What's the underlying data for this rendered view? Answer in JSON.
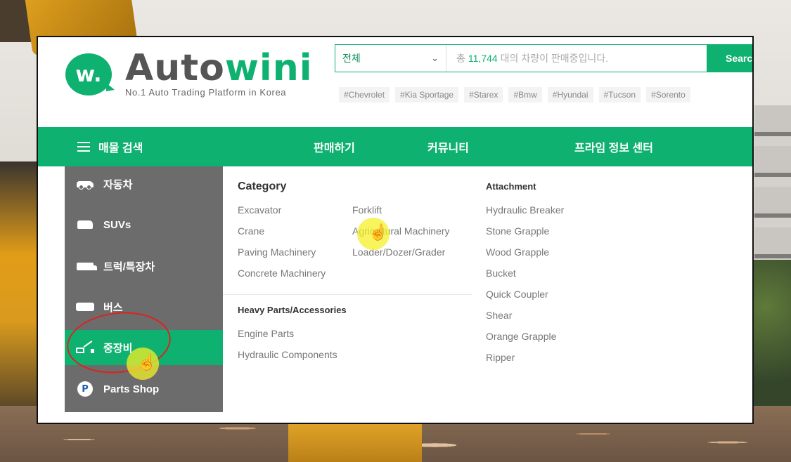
{
  "header": {
    "logo_mark": "w.",
    "logo_auto": "Auto",
    "logo_wini": "wini",
    "tagline": "No.1 Auto Trading Platform in Korea"
  },
  "search": {
    "category_value": "전체",
    "placeholder_prefix": "총",
    "vehicle_count": "11,744",
    "placeholder_suffix": "대의 차량이 판매중입니다.",
    "button_label": "Search"
  },
  "tags": [
    "#Chevrolet",
    "#Kia Sportage",
    "#Starex",
    "#Bmw",
    "#Hyundai",
    "#Tucson",
    "#Sorento"
  ],
  "nav": {
    "menu_label": "매물 검색",
    "items": [
      "판매하기",
      "커뮤니티",
      "프라임 정보 센터"
    ]
  },
  "sidebar": {
    "items": [
      {
        "label": "자동차",
        "icon": "car-icon"
      },
      {
        "label": "SUVs",
        "icon": "suv-icon"
      },
      {
        "label": "트럭/특장차",
        "icon": "truck-icon"
      },
      {
        "label": "버스",
        "icon": "bus-icon"
      },
      {
        "label": "중장비",
        "icon": "excavator-icon",
        "active": true
      },
      {
        "label": "Parts Shop",
        "icon": "parts-shop-icon"
      }
    ]
  },
  "category": {
    "title": "Category",
    "col1": [
      "Excavator",
      "Crane",
      "Paving Machinery",
      "Concrete Machinery"
    ],
    "col2": [
      "Forklift",
      "Agricultural Machinery",
      "Loader/Dozer/Grader"
    ]
  },
  "heavy_parts": {
    "title": "Heavy Parts/Accessories",
    "items": [
      "Engine Parts",
      "Hydraulic Components"
    ]
  },
  "attachment": {
    "title": "Attachment",
    "items": [
      "Hydraulic Breaker",
      "Stone Grapple",
      "Wood Grapple",
      "Bucket",
      "Quick Coupler",
      "Shear",
      "Orange Grapple",
      "Ripper"
    ]
  },
  "colors": {
    "brand_green": "#0fb170",
    "sidebar_gray": "#6c6c6c",
    "annotation_red": "#d9241f",
    "cursor_highlight": "#f6f028"
  }
}
